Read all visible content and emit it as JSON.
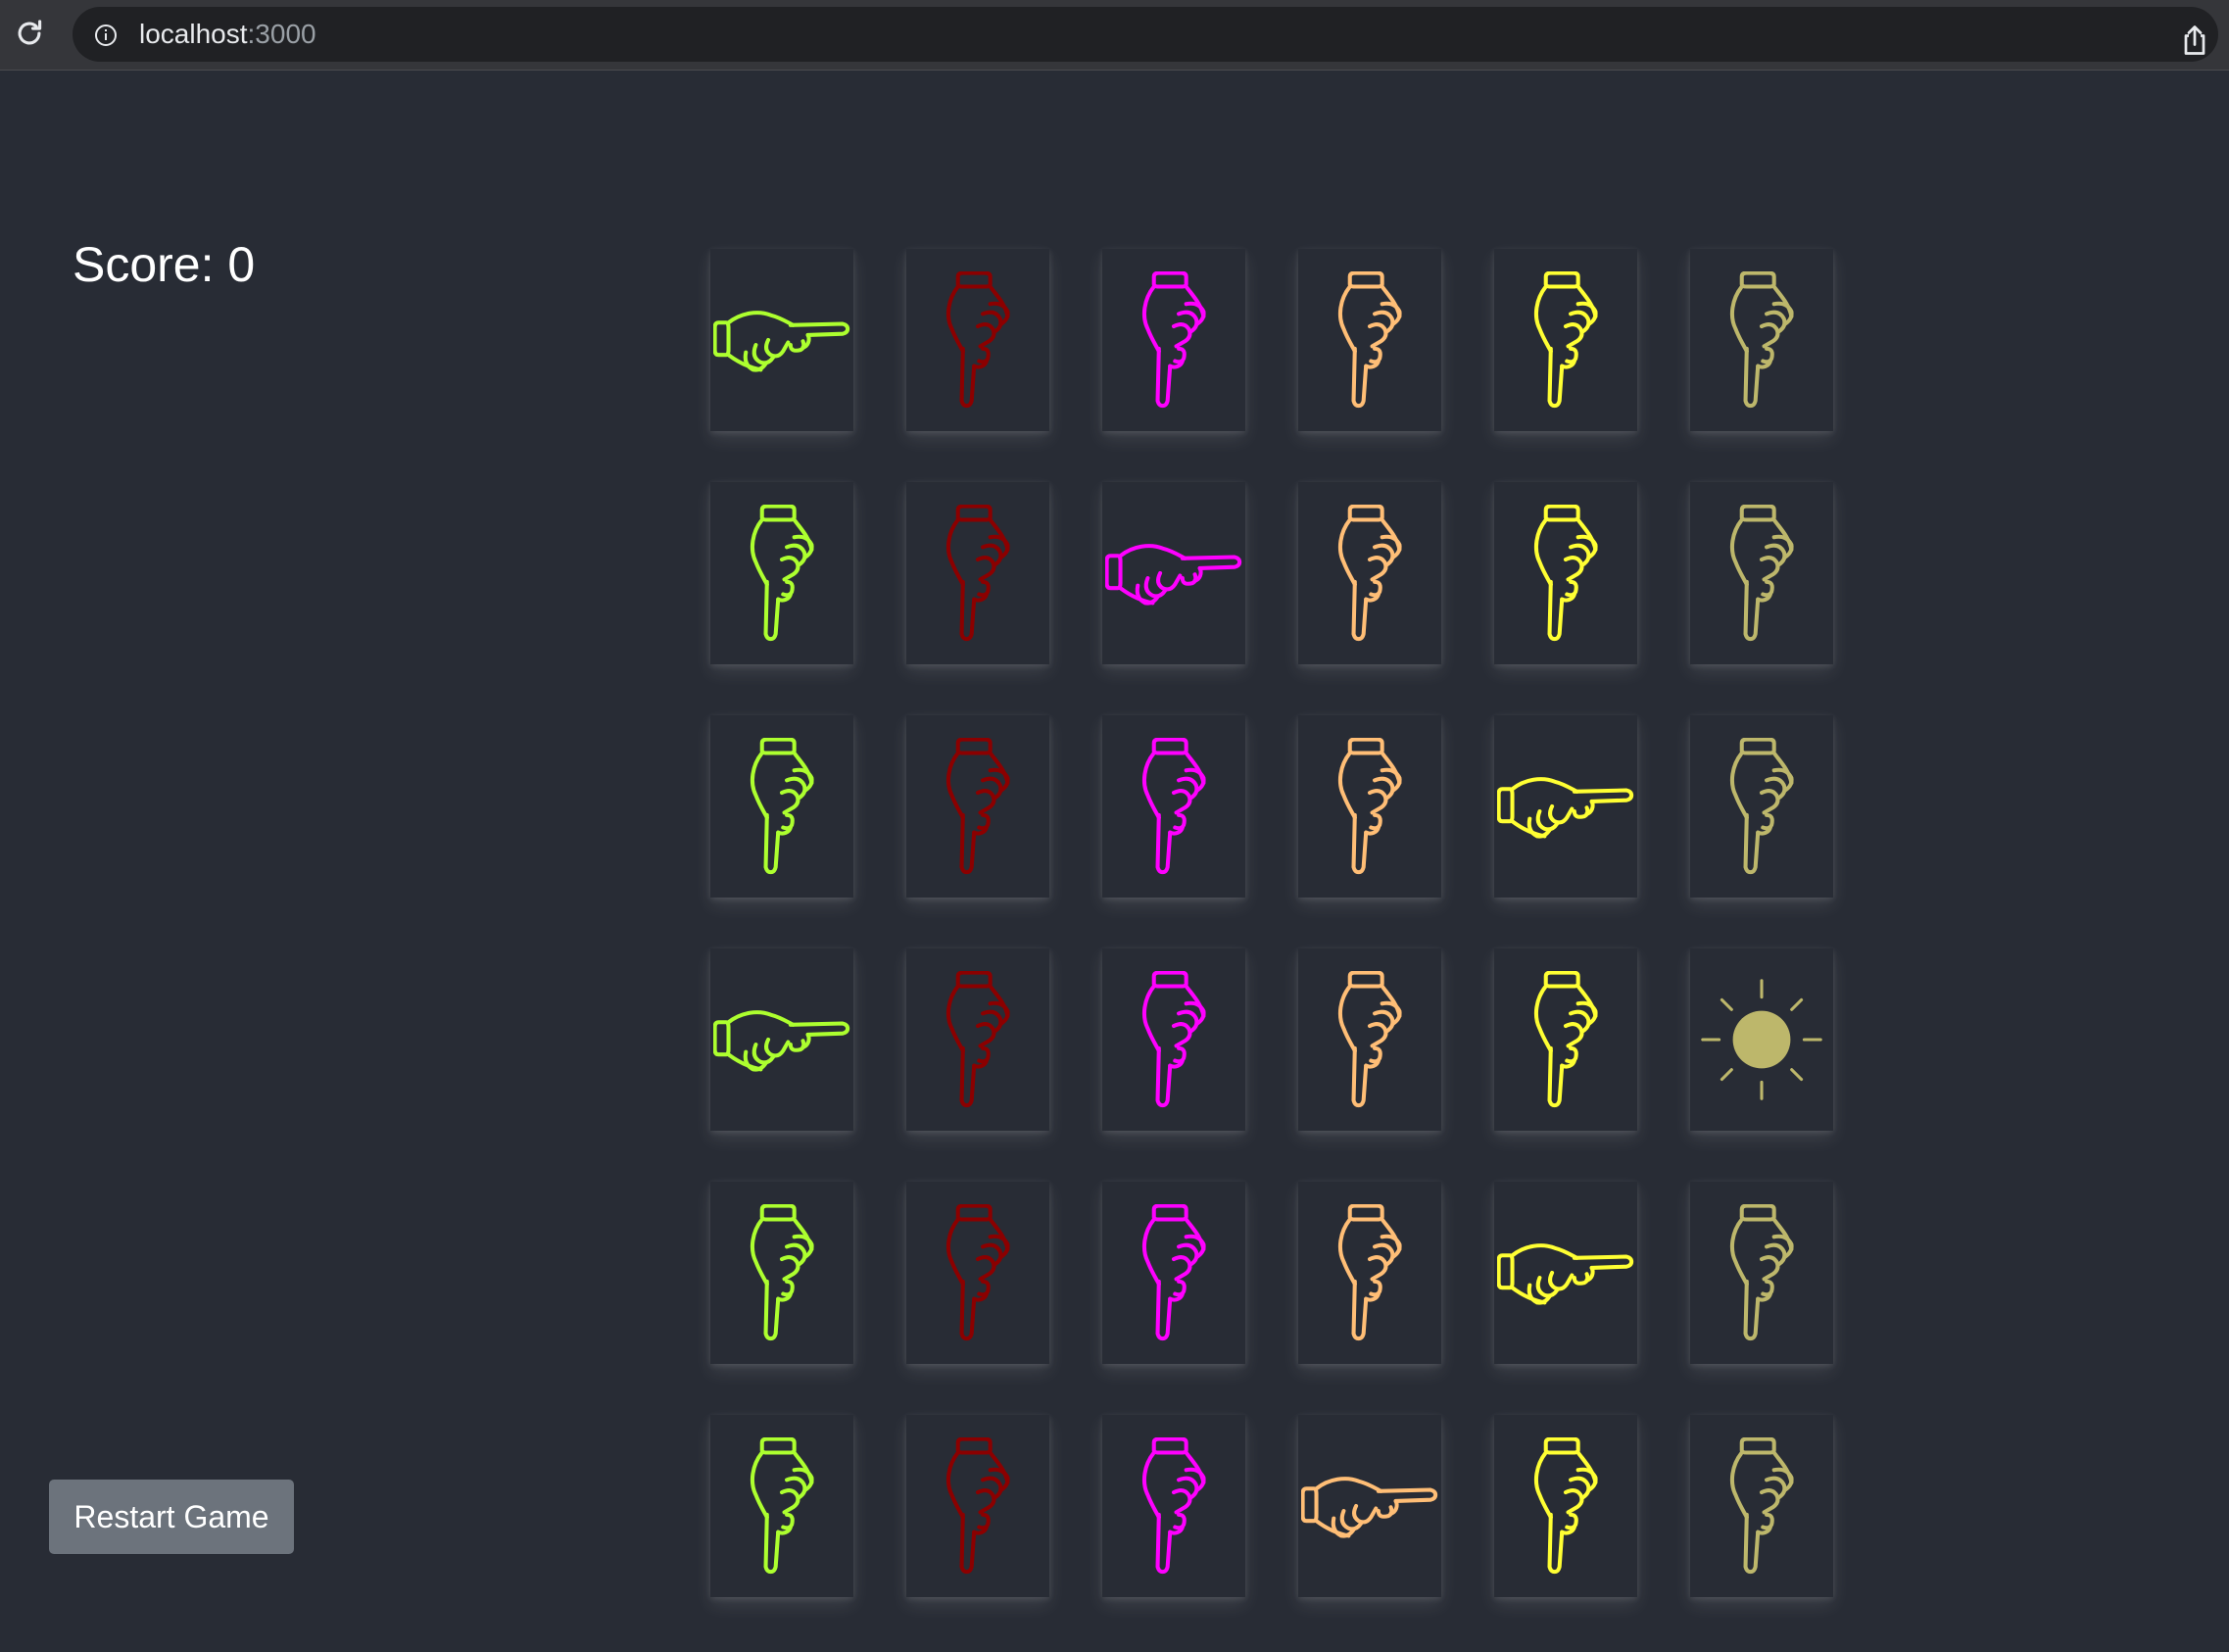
{
  "browser": {
    "host": "localhost",
    "port": ":3000"
  },
  "game": {
    "score_label": "Score: 0",
    "restart_label": "Restart Game"
  },
  "colors": {
    "page_bg": "#282c35",
    "card_bg": "#282c35",
    "button_bg": "#6c737c",
    "green": "#adff2f",
    "darkred": "#8b0000",
    "magenta": "#ff00ff",
    "orange": "#ffbe76",
    "yellow": "#ffff33",
    "khaki": "#bdb76b"
  },
  "board": {
    "columns": 6,
    "rows": [
      [
        "right",
        "down",
        "down",
        "down",
        "down",
        "down"
      ],
      [
        "down",
        "down",
        "right",
        "down",
        "down",
        "down"
      ],
      [
        "down",
        "down",
        "down",
        "down",
        "right",
        "down"
      ],
      [
        "right",
        "down",
        "down",
        "down",
        "down",
        "sun"
      ],
      [
        "down",
        "down",
        "down",
        "down",
        "right",
        "down"
      ],
      [
        "down",
        "down",
        "down",
        "right",
        "down",
        "down"
      ]
    ],
    "column_colors": [
      "green",
      "darkred",
      "magenta",
      "orange",
      "yellow",
      "khaki"
    ]
  }
}
